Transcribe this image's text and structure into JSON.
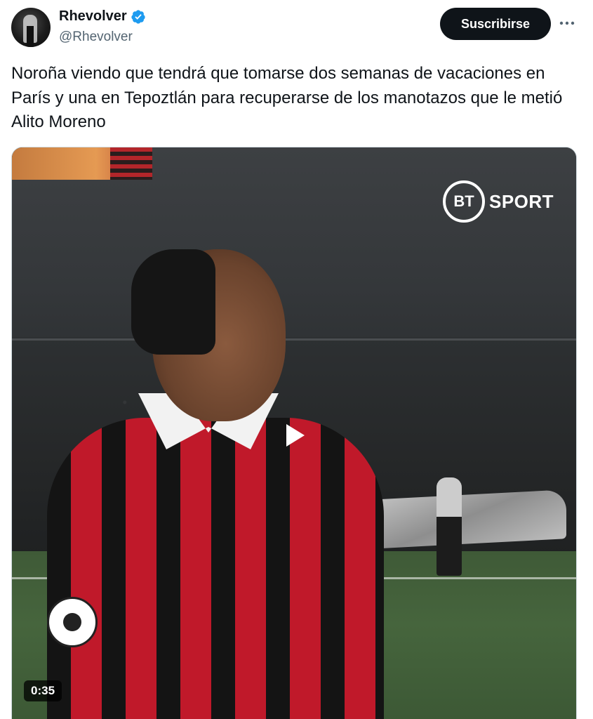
{
  "author": {
    "name": "Rhevolver",
    "handle": "@Rhevolver",
    "verified": true,
    "avatar_icon": "profile-photo"
  },
  "actions": {
    "subscribe_label": "Suscribirse",
    "more_icon": "more-dots-icon"
  },
  "tweet": {
    "text": "Noroña viendo que tendrá que tomarse dos semanas de vacaciones en París y una en Tepoztlán para recuperarse de los manotazos que le metió Alito Moreno"
  },
  "media": {
    "type": "video",
    "duration": "0:35",
    "watermark_circle": "BT",
    "watermark_text": "SPORT",
    "play_icon": "play-icon"
  },
  "colors": {
    "button_bg": "#0f1419",
    "verified_blue": "#1d9bf0",
    "handle_gray": "#536471",
    "border": "#cfd9de"
  }
}
